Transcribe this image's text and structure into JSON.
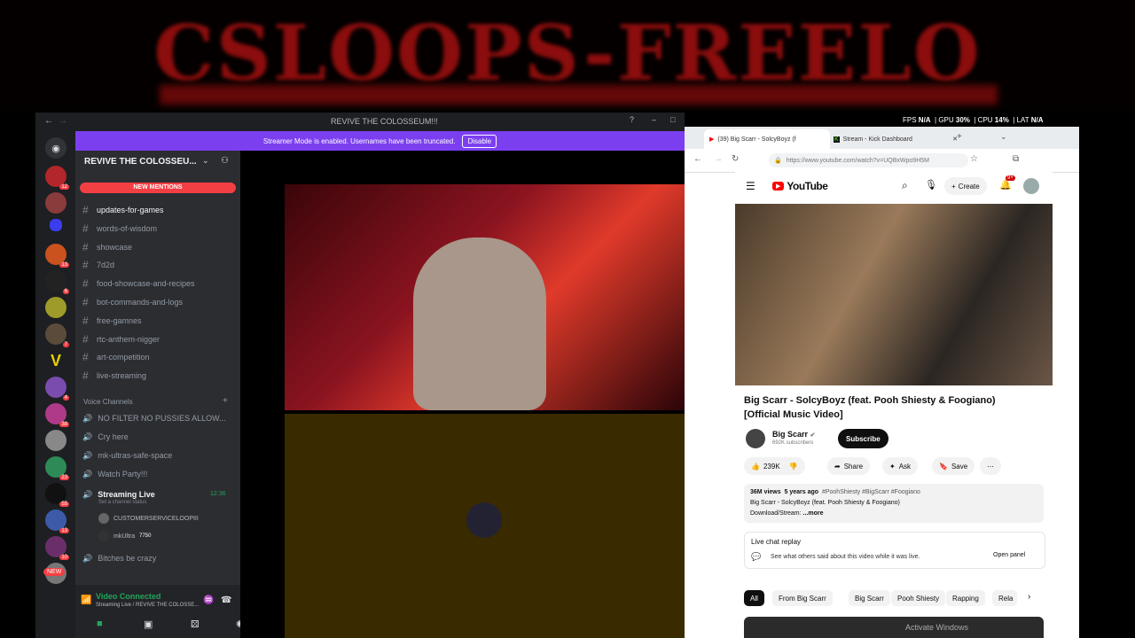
{
  "banner": {
    "text": "CSLOOPS-FREELO"
  },
  "overlay": {
    "fps_label": "FPS",
    "fps": "N/A",
    "gpu_label": "GPU",
    "gpu": "30%",
    "cpu_label": "CPU",
    "cpu": "14%",
    "lat_label": "LAT",
    "lat": "N/A"
  },
  "discord": {
    "window_title": "REVIVE THE COLOSSEUM!!!",
    "streamer_mode": "Streamer Mode is enabled. Usernames have been truncated.",
    "disable": "Disable",
    "server_name": "REVIVE THE COLOSSEU...",
    "new_mentions": "NEW MENTIONS",
    "text_channels": [
      {
        "name": "updates-for-games",
        "unread": true
      },
      {
        "name": "words-of-wisdom",
        "unread": false
      },
      {
        "name": "showcase",
        "unread": false
      },
      {
        "name": "7d2d",
        "unread": false
      },
      {
        "name": "food-showcase-and-recipes",
        "unread": false
      },
      {
        "name": "bot-commands-and-logs",
        "unread": false
      },
      {
        "name": "free-gamnes",
        "unread": false
      },
      {
        "name": "rtc-anthem-nigger",
        "unread": false
      },
      {
        "name": "art-competition",
        "unread": false
      },
      {
        "name": "live-streaming",
        "unread": false
      }
    ],
    "voice_header": "Voice Channels",
    "voice_channels": [
      "NO FILTER NO PUSSIES ALLOW...",
      "Cry here",
      "mk-ultras-safe-space",
      "Watch Party!!!"
    ],
    "active_voice": {
      "name": "Streaming Live",
      "time": "12:36",
      "status": "Set a channel status"
    },
    "voice_users": [
      {
        "name": "CUSTOMERSERVICELOOPIII"
      },
      {
        "name": "mkUltra",
        "badge": "7750"
      }
    ],
    "last_channel": "Bitches be crazy",
    "connection": {
      "title": "Video Connected",
      "sub": "Streaming Live / REVIVE THE COLOSSE..."
    },
    "server_badges": [
      "12",
      "13",
      "6",
      "7",
      "4",
      "38",
      "23",
      "55",
      "13",
      "10"
    ],
    "new_label": "NEW"
  },
  "browser": {
    "tabs": [
      {
        "label": "(39) Big Scarr - SolcyBoyz (f"
      },
      {
        "label": "Stream - Kick Dashboard"
      }
    ],
    "url": "https://www.youtube.com/watch?v=UQBxWpo9H5M",
    "yt": {
      "logo": "YouTube",
      "create": "Create",
      "notif_count": "9+",
      "title": "Big Scarr - SolcyBoyz (feat. Pooh Shiesty & Foogiano) [Official Music Video]",
      "channel": "Big Scarr",
      "subs": "692K subscribers",
      "subscribe": "Subscribe",
      "likes": "239K",
      "share": "Share",
      "ask": "Ask",
      "save": "Save",
      "views": "36M views",
      "ago": "5 years ago",
      "tags": "#PoohShiesty #BigScarr #Foogiano",
      "desc_line": "Big Scarr - SolcyBoyz (feat. Pooh Shiesty & Foogiano)",
      "desc_line2": "Download/Stream:",
      "more": "...more",
      "live_chat": "Live chat replay",
      "live_chat_sub": "See what others said about this video while it was live.",
      "open_panel": "Open panel",
      "chips": [
        "All",
        "From Big Scarr",
        "Big Scarr",
        "Pooh Shiesty",
        "Rapping",
        "Rela"
      ],
      "watermark": "Activate Windows"
    }
  }
}
